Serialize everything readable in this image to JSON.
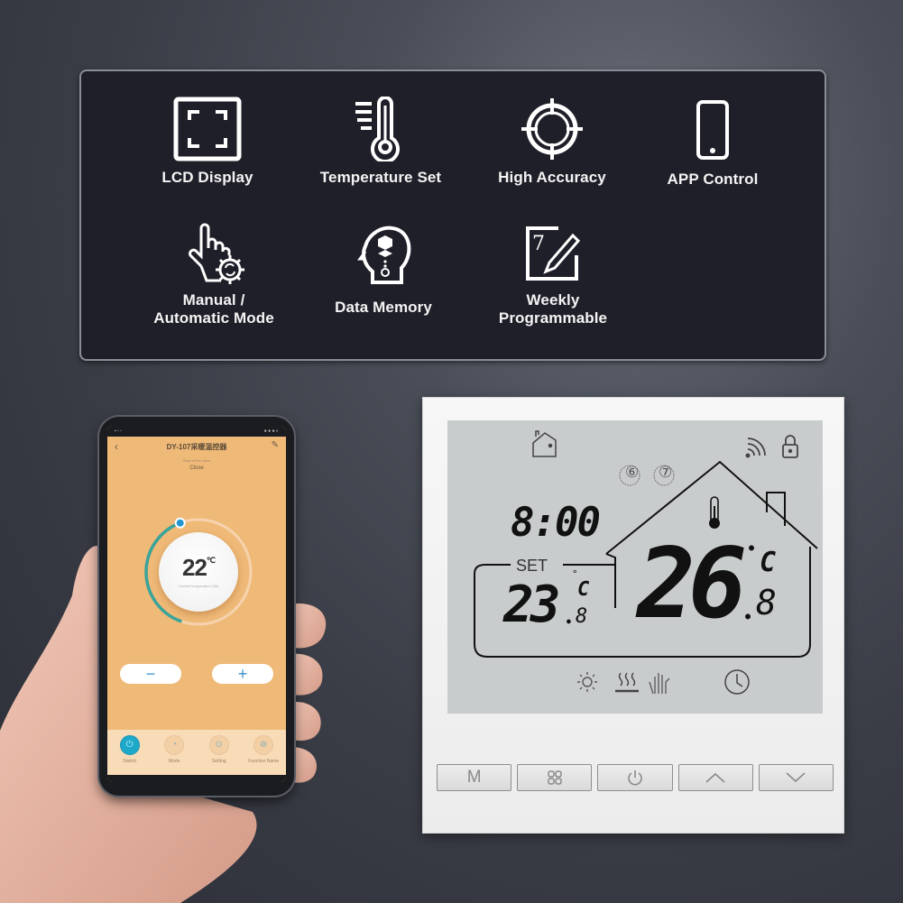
{
  "features": [
    {
      "icon": "lcd-display-icon",
      "label": "LCD Display"
    },
    {
      "icon": "temperature-set-icon",
      "label": "Temperature Set"
    },
    {
      "icon": "high-accuracy-icon",
      "label": "High Accuracy"
    },
    {
      "icon": "app-control-icon",
      "label": "APP Control"
    },
    {
      "icon": "manual-automatic-mode-icon",
      "label_line1": "Manual /",
      "label_line2": "Automatic Mode"
    },
    {
      "icon": "data-memory-icon",
      "label": "Data Memory"
    },
    {
      "icon": "weekly-programmable-icon",
      "label_line1": "Weekly",
      "label_line2": "Programmable"
    }
  ],
  "phone_app": {
    "title": "DY-107采暖温控器",
    "back_icon": "chevron-left-icon",
    "edit_icon": "edit-icon",
    "state_caption": "State of the valve",
    "state_value": "Close",
    "current_temperature": "22",
    "temperature_unit": "℃",
    "temperature_caption": "Current temperature (35)",
    "dial_level_fraction": 0.5,
    "minus_label": "−",
    "plus_label": "+",
    "tabs": [
      {
        "label": "Switch",
        "icon": "power-icon",
        "active": true
      },
      {
        "label": "Mode",
        "icon": "mode-icon",
        "active": false
      },
      {
        "label": "Setting",
        "icon": "setting-icon",
        "active": false
      },
      {
        "label": "Function Name",
        "icon": "function-icon",
        "active": false
      }
    ]
  },
  "thermostat": {
    "time": "8:00",
    "day_indicators": [
      "⑥",
      "⑦"
    ],
    "set_label": "SET",
    "set_temp_int": "23",
    "set_temp_dec": "8",
    "room_temp_int": "26",
    "room_temp_dec": "8",
    "unit_c": "C",
    "buttons": [
      {
        "label": "M",
        "icon": "mode-button"
      },
      {
        "label": "",
        "icon": "menu-grid-icon"
      },
      {
        "label": "",
        "icon": "power-icon"
      },
      {
        "label": "",
        "icon": "chevron-up-icon"
      },
      {
        "label": "",
        "icon": "chevron-down-icon"
      }
    ]
  }
}
